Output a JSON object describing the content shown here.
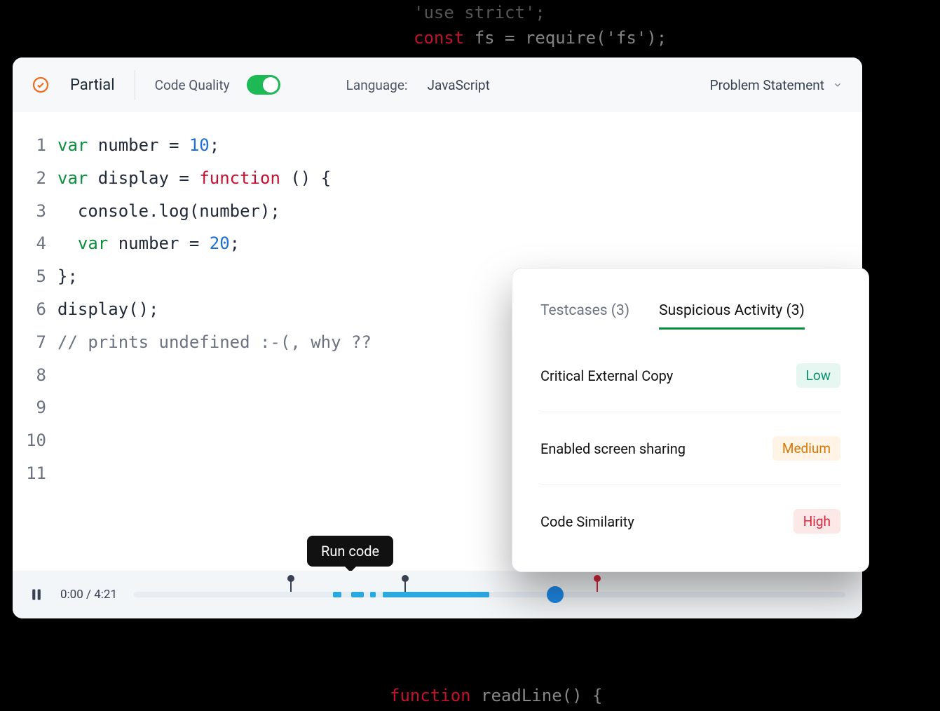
{
  "background_code": {
    "line1": "'use strict';",
    "line2_kw": "const",
    "line2_rest": " fs = require('fs');",
    "line3_kw": "function",
    "line3_rest": " readLine() {"
  },
  "header": {
    "status": "Partial",
    "code_quality_label": "Code Quality",
    "code_quality_on": true,
    "language_label": "Language:",
    "language_value": "JavaScript",
    "problem_statement": "Problem Statement"
  },
  "code_lines": [
    {
      "n": "1",
      "html": "<span class='kw'>var</span> number = <span class='num'>10</span>;"
    },
    {
      "n": "2",
      "html": "<span class='kw'>var</span> display = <span class='fn'>function</span> () {"
    },
    {
      "n": "3",
      "html": "  console.log(number);"
    },
    {
      "n": "4",
      "html": "  <span class='kw'>var</span> number = <span class='num'>20</span>;"
    },
    {
      "n": "5",
      "html": "};"
    },
    {
      "n": "6",
      "html": "display();"
    },
    {
      "n": "7",
      "html": "<span class='cm'>// prints undefined :-(, why ??</span>"
    },
    {
      "n": "8",
      "html": ""
    },
    {
      "n": "9",
      "html": ""
    },
    {
      "n": "10",
      "html": ""
    },
    {
      "n": "11",
      "html": ""
    }
  ],
  "playback": {
    "current": "0:00",
    "total": "4:21",
    "tooltip": "Run code"
  },
  "activity": {
    "tabs": [
      {
        "label": "Testcases (3)",
        "active": false
      },
      {
        "label": "Suspicious Activity (3)",
        "active": true
      }
    ],
    "rows": [
      {
        "label": "Critical External Copy",
        "level": "Low",
        "cls": "badge-low"
      },
      {
        "label": "Enabled screen sharing",
        "level": "Medium",
        "cls": "badge-med"
      },
      {
        "label": "Code Similarity",
        "level": "High",
        "cls": "badge-high"
      }
    ]
  }
}
